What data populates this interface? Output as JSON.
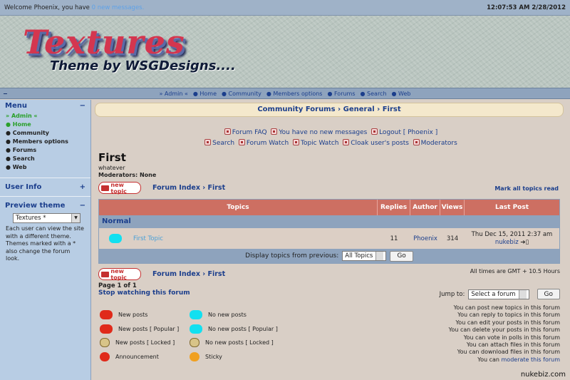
{
  "topbar": {
    "welcome": "Welcome Phoenix, you have",
    "messages_link": "0 new messages.",
    "clock": "12:07:53 AM 2/28/2012"
  },
  "banner": {
    "title": "Textures",
    "subtitle": "Theme by WSGDesigns...."
  },
  "navbar": {
    "toggle": "−",
    "items": [
      "» Admin «",
      "● Home",
      "● Community",
      "● Members options",
      "● Forums",
      "● Search",
      "● Web"
    ]
  },
  "sidebar": {
    "menu_title": "Menu",
    "menu_toggle": "−",
    "items": [
      "» Admin «",
      "● Home",
      "● Community",
      "● Members options",
      "● Forums",
      "● Search",
      "● Web"
    ],
    "userinfo_title": "User Info",
    "userinfo_toggle": "+",
    "theme_title": "Preview theme",
    "theme_toggle": "−",
    "theme_value": "Textures *",
    "theme_note": "Each user can view the site with a different theme. Themes marked with a * also change the forum look."
  },
  "breadcrumb": {
    "label": "Community Forums › General › First"
  },
  "links1": [
    "Forum FAQ",
    "You have no new messages",
    "Logout [ Phoenix ]"
  ],
  "links2": [
    "Search",
    "Forum Watch",
    "Topic Watch",
    "Cloak user's posts",
    "Moderators"
  ],
  "forum": {
    "title": "First",
    "desc": "whatever",
    "mods": "Moderators: None"
  },
  "newtopic": "new topic",
  "path": {
    "index": "Forum Index",
    "sep": " › ",
    "name": "First"
  },
  "markall": "Mark all topics read",
  "table": {
    "headers": [
      "Topics",
      "Replies",
      "Author",
      "Views",
      "Last Post"
    ],
    "category": "Normal",
    "row": {
      "topic": "First Topic",
      "replies": "11",
      "author": "Phoenix",
      "views": "314",
      "last_date": "Thu Dec 15, 2011 2:37 am",
      "last_user": "nukebiz"
    },
    "footer_label": "Display topics from previous:",
    "select": "All Topics",
    "go": "Go"
  },
  "timezone": "All times are GMT + 10.5 Hours",
  "pages": "Page 1 of 1",
  "stopwatch": "Stop watching this forum",
  "jump": {
    "label": "Jump to:",
    "select": "Select a forum",
    "go": "Go"
  },
  "legend": [
    [
      "New posts",
      "No new posts"
    ],
    [
      "New posts [ Popular ]",
      "No new posts [ Popular ]"
    ],
    [
      "New posts [ Locked ]",
      "No new posts [ Locked ]"
    ],
    [
      "Announcement",
      "Sticky"
    ]
  ],
  "permissions": [
    "You can post new topics in this forum",
    "You can reply to topics in this forum",
    "You can edit your posts in this forum",
    "You can delete your posts in this forum",
    "You can vote in polls in this forum",
    "You can attach files in this forum",
    "You can download files in this forum"
  ],
  "moderate": {
    "prefix": "You can",
    "link": "moderate this forum"
  },
  "footer_tag": "nukebiz.com",
  "colors": {
    "accent": "#1b3e8c",
    "header": "#cd6f62",
    "nav": "#8ea3bd",
    "sidebar": "#b8cde4",
    "new_icon": "#e02a1a",
    "no_new_icon": "#12e0f0"
  }
}
